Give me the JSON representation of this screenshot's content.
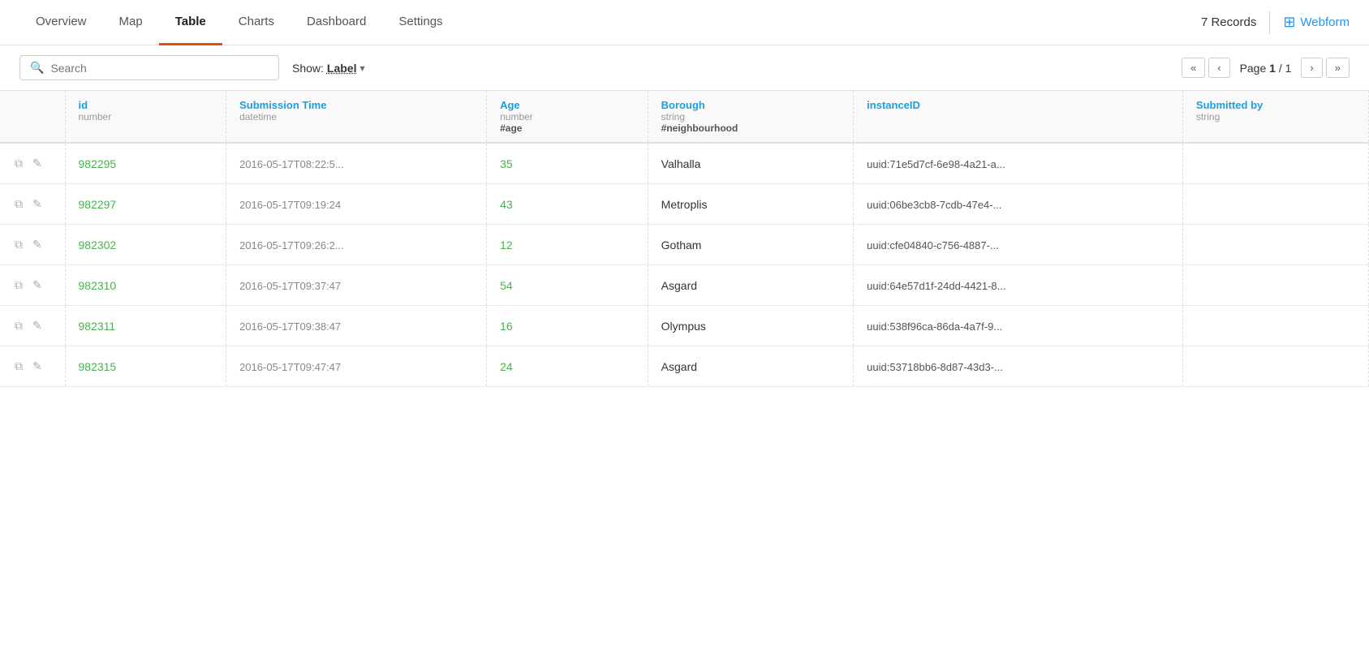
{
  "nav": {
    "tabs": [
      {
        "label": "Overview",
        "active": false
      },
      {
        "label": "Map",
        "active": false
      },
      {
        "label": "Table",
        "active": true
      },
      {
        "label": "Charts",
        "active": false
      },
      {
        "label": "Dashboard",
        "active": false
      },
      {
        "label": "Settings",
        "active": false
      }
    ],
    "record_count": "7 Records",
    "webform_label": "Webform"
  },
  "toolbar": {
    "search_placeholder": "Search",
    "show_label": "Show:",
    "show_value": "Label",
    "page_info": "Page",
    "page_current": "1",
    "page_total": "1",
    "page_separator": "/"
  },
  "table": {
    "columns": [
      {
        "name": "",
        "type": "",
        "alias": ""
      },
      {
        "name": "id",
        "type": "number",
        "alias": ""
      },
      {
        "name": "Submission Time",
        "type": "datetime",
        "alias": ""
      },
      {
        "name": "Age",
        "type": "number",
        "alias": "#age"
      },
      {
        "name": "Borough",
        "type": "string",
        "alias": "#neighbourhood"
      },
      {
        "name": "instanceID",
        "type": "",
        "alias": ""
      },
      {
        "name": "Submitted by",
        "type": "string",
        "alias": ""
      }
    ],
    "rows": [
      {
        "id": "982295",
        "submission_time": "2016-05-17T08:22:5...",
        "age": "35",
        "borough": "Valhalla",
        "instance_id": "uuid:71e5d7cf-6e98-4a21-a...",
        "submitted_by": ""
      },
      {
        "id": "982297",
        "submission_time": "2016-05-17T09:19:24",
        "age": "43",
        "borough": "Metroplis",
        "instance_id": "uuid:06be3cb8-7cdb-47e4-...",
        "submitted_by": ""
      },
      {
        "id": "982302",
        "submission_time": "2016-05-17T09:26:2...",
        "age": "12",
        "borough": "Gotham",
        "instance_id": "uuid:cfe04840-c756-4887-...",
        "submitted_by": ""
      },
      {
        "id": "982310",
        "submission_time": "2016-05-17T09:37:47",
        "age": "54",
        "borough": "Asgard",
        "instance_id": "uuid:64e57d1f-24dd-4421-8...",
        "submitted_by": ""
      },
      {
        "id": "982311",
        "submission_time": "2016-05-17T09:38:47",
        "age": "16",
        "borough": "Olympus",
        "instance_id": "uuid:538f96ca-86da-4a7f-9...",
        "submitted_by": ""
      },
      {
        "id": "982315",
        "submission_time": "2016-05-17T09:47:47",
        "age": "24",
        "borough": "Asgard",
        "instance_id": "uuid:53718bb6-8d87-43d3-...",
        "submitted_by": ""
      }
    ]
  },
  "icons": {
    "search": "🔍",
    "copy": "⧉",
    "edit": "✎",
    "chevron_down": "▾",
    "first_page": "«",
    "prev_page": "‹",
    "next_page": "›",
    "last_page": "»",
    "webform": "⊞"
  }
}
